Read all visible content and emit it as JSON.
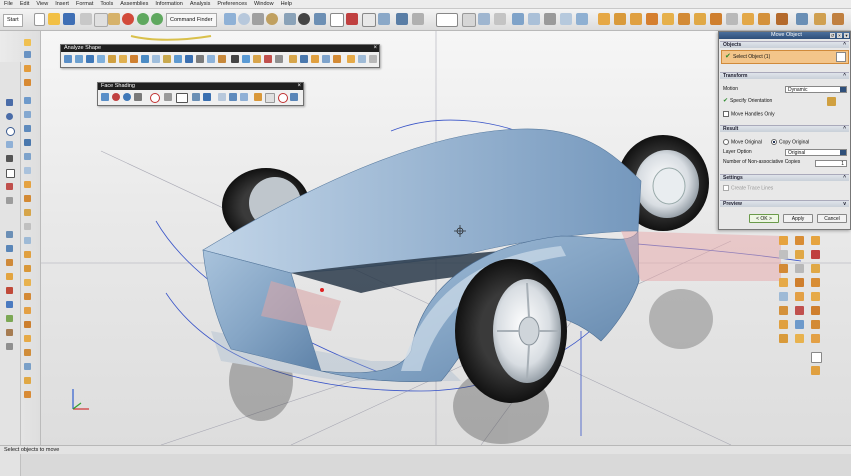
{
  "menu": {
    "items": [
      "File",
      "Edit",
      "View",
      "Insert",
      "Format",
      "Tools",
      "Assemblies",
      "Information",
      "Analysis",
      "Preferences",
      "Window",
      "Help"
    ]
  },
  "toolbar": {
    "start_label": "Start",
    "command_finder_label": "Command Finder"
  },
  "status": {
    "text": "Select objects to move"
  },
  "analyze_shape_bar": {
    "title": "Analyze Shape"
  },
  "face_shading_bar": {
    "title": "Face Shading"
  },
  "dialog": {
    "title": "Move Object",
    "objects": {
      "header": "Objects",
      "select_label": "Select Object (1)"
    },
    "transform": {
      "header": "Transform",
      "motion_label": "Motion",
      "motion_value": "Dynamic",
      "specify_orientation": "Specify Orientation",
      "move_handles_only": "Move Handles Only"
    },
    "result": {
      "header": "Result",
      "move_original": "Move Original",
      "copy_original": "Copy Original",
      "layer_option_label": "Layer Option",
      "layer_option_value": "Original",
      "copies_label": "Number of Non-associative Copies",
      "copies_value": "1"
    },
    "settings": {
      "header": "Settings",
      "create_trace_lines": "Create Trace Lines"
    },
    "preview": {
      "header": "Preview"
    },
    "buttons": {
      "ok": "< OK >",
      "apply": "Apply",
      "cancel": "Cancel"
    }
  },
  "colors": {
    "body_blue": "#9ab5cf",
    "title_bar": "#2e4f7a",
    "toolbar_bg": "#e4e4e4",
    "select_highlight": "#f3c58a"
  }
}
